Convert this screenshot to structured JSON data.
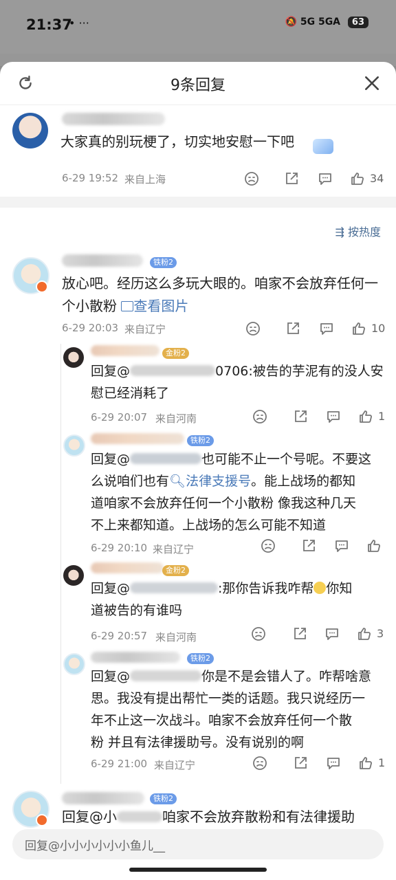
{
  "status_bar": {
    "time": "21:37",
    "indicators": "5G 5GA",
    "battery": "63"
  },
  "sheet": {
    "title": "9条回复",
    "sort_label": "按热度"
  },
  "main_comment": {
    "text": "大家真的别玩梗了，切实地安慰一下吧",
    "time": "6-29 19:52",
    "location": "来自上海",
    "like_count": "34"
  },
  "replies": [
    {
      "fan_badge": "铁粉2",
      "text_line1": "放心吧。经历这么多玩大眼的。咱家不会放弃任何一",
      "text_line2": "个小散粉",
      "view_image": "查看图片",
      "time": "6-29 20:03",
      "location": "来自辽宁",
      "like_count": "10"
    }
  ],
  "sub_replies": [
    {
      "fan_badge": "金粉2",
      "prefix": "回复@",
      "suffix_line1": "0706:被告的芋泥有的没人安",
      "line2": "慰已经消耗了",
      "time": "6-29 20:07",
      "location": "来自河南",
      "like_count": "1"
    },
    {
      "fan_badge": "铁粉2",
      "prefix": "回复@",
      "suffix_line1": "也可能不止一个号呢。不要这",
      "line2_pre": "么说咱们也有",
      "line2_link": "法律支援号",
      "line2_post": "。能上战场的都知",
      "line3": "道咱家不会放弃任何一个小散粉 像我这种几天",
      "line4": "不上来都知道。上战场的怎么可能不知道",
      "time": "6-29 20:10",
      "location": "来自辽宁",
      "like_count": ""
    },
    {
      "fan_badge": "金粉2",
      "prefix": "回复@",
      "suffix_line1": ":那你告诉我咋帮",
      "suffix_line1b": "你知",
      "line2": "道被告的有谁吗",
      "time": "6-29 20:57",
      "location": "来自河南",
      "like_count": "3"
    },
    {
      "fan_badge": "铁粉2",
      "prefix": "回复@",
      "suffix_line1": "你是不是会错人了。咋帮啥意",
      "line2": "思。我没有提出帮忙一类的话题。我只说经历一",
      "line3": "年不止这一次战斗。咱家不会放弃任何一个散",
      "line4": "粉 并且有法律援助号。没有说别的啊",
      "time": "6-29 21:00",
      "location": "来自辽宁",
      "like_count": "1"
    }
  ],
  "last_reply": {
    "fan_badge": "铁粉2",
    "prefix": "回复@小",
    "suffix": "咱家不会放弃散粉和有法律援助"
  },
  "input": {
    "placeholder": "回复@小小小小小小鱼儿__"
  },
  "colors": {
    "link": "#4a7ab8",
    "iron_badge": "#6b9be8",
    "gold_badge": "#e3b04b"
  }
}
